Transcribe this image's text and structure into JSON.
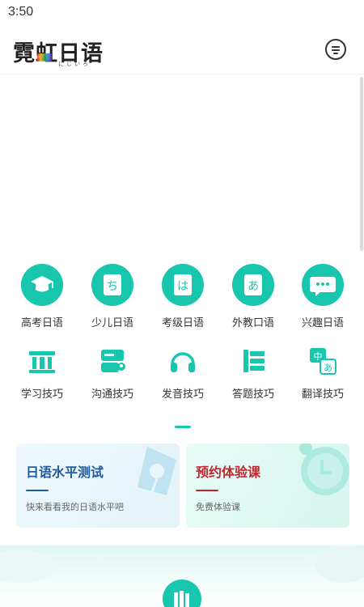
{
  "status_bar": {
    "time": "3:50"
  },
  "header": {
    "logo_text": "霓虹日语",
    "logo_subtext": "にじいろ",
    "message_icon": "message-icon"
  },
  "categories_row1": [
    {
      "label": "高考日语",
      "icon": "graduation-cap-icon"
    },
    {
      "label": "少儿日语",
      "icon": "book-chi-icon"
    },
    {
      "label": "考级日语",
      "icon": "book-ha-icon"
    },
    {
      "label": "外教口语",
      "icon": "book-a-icon"
    },
    {
      "label": "兴趣日语",
      "icon": "chat-bubble-icon"
    }
  ],
  "categories_row2": [
    {
      "label": "学习技巧",
      "icon": "building-icon"
    },
    {
      "label": "沟通技巧",
      "icon": "contact-card-icon"
    },
    {
      "label": "发音技巧",
      "icon": "headphones-icon"
    },
    {
      "label": "答题技巧",
      "icon": "answer-sheet-icon"
    },
    {
      "label": "翻译技巧",
      "icon": "translate-icon"
    }
  ],
  "promo_cards": [
    {
      "title": "日语水平测试",
      "subtitle": "快来看看我的日语水平吧",
      "icon": "pen-nib-icon"
    },
    {
      "title": "预约体验课",
      "subtitle": "免费体验课",
      "icon": "alarm-clock-icon"
    }
  ],
  "colors": {
    "accent": "#18c5ad",
    "card_a_title": "#1e5aa0",
    "card_b_title": "#c0272d"
  },
  "bottom": {
    "icon": "books-icon"
  }
}
